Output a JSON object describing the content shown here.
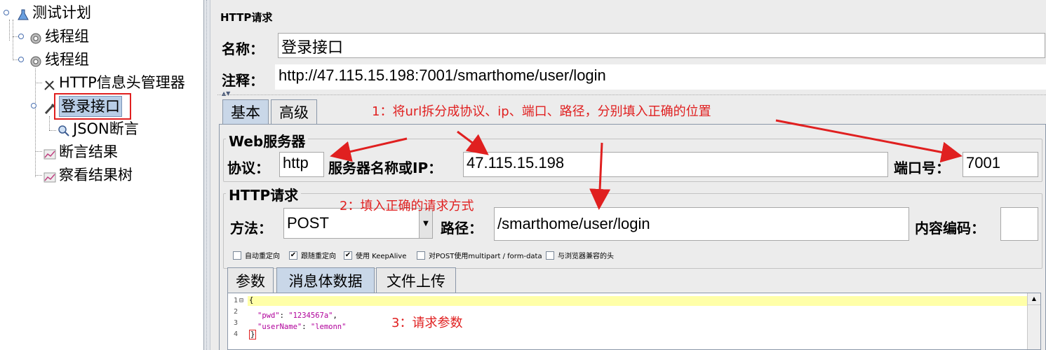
{
  "tree": {
    "test_plan": "测试计划",
    "thread_group_1": "线程组",
    "thread_group_2": "线程组",
    "header_manager": "HTTP信息头管理器",
    "login_interface": "登录接口",
    "json_assertion": "JSON断言",
    "assertion_results": "断言结果",
    "view_results_tree": "察看结果树"
  },
  "panel": {
    "title": "HTTP请求",
    "name_label": "名称：",
    "name_value": "登录接口",
    "comment_label": "注释：",
    "comment_value": "http://47.115.15.198:7001/smarthome/user/login"
  },
  "tabs": {
    "basic": "基本",
    "advanced": "高级"
  },
  "web_server": {
    "title": "Web服务器",
    "protocol_label": "协议：",
    "protocol_value": "http",
    "server_label": "服务器名称或IP：",
    "server_value": "47.115.15.198",
    "port_label": "端口号：",
    "port_value": "7001"
  },
  "http_request": {
    "title": "HTTP请求",
    "method_label": "方法：",
    "method_value": "POST",
    "path_label": "路径：",
    "path_value": "/smarthome/user/login",
    "encoding_label": "内容编码：",
    "encoding_value": ""
  },
  "checkboxes": [
    {
      "label": "自动重定向",
      "checked": false
    },
    {
      "label": "跟随重定向",
      "checked": true
    },
    {
      "label": "使用 KeepAlive",
      "checked": true
    },
    {
      "label": "对POST使用multipart / form-data",
      "checked": false
    },
    {
      "label": "与浏览器兼容的头",
      "checked": false
    }
  ],
  "sub_tabs": {
    "params": "参数",
    "body": "消息体数据",
    "files": "文件上传"
  },
  "body_lines": {
    "line_numbers": [
      "1",
      "2",
      "3",
      "4"
    ],
    "l1": "{",
    "l2_key": "\"pwd\"",
    "l2_val": "\"1234567a\"",
    "l3_key": "\"userName\"",
    "l3_val": "\"lemonn\"",
    "l4": "}"
  },
  "annotations": {
    "a1": "1：将url拆分成协议、ip、端口、路径，分别填入正确的位置",
    "a2": "2：填入正确的请求方式",
    "a3": "3：请求参数"
  },
  "colors": {
    "annotation": "#e02020",
    "selected_tab": "#c9d7e8",
    "highlight_line": "#ffffa8",
    "json_key": "#b0009a"
  }
}
